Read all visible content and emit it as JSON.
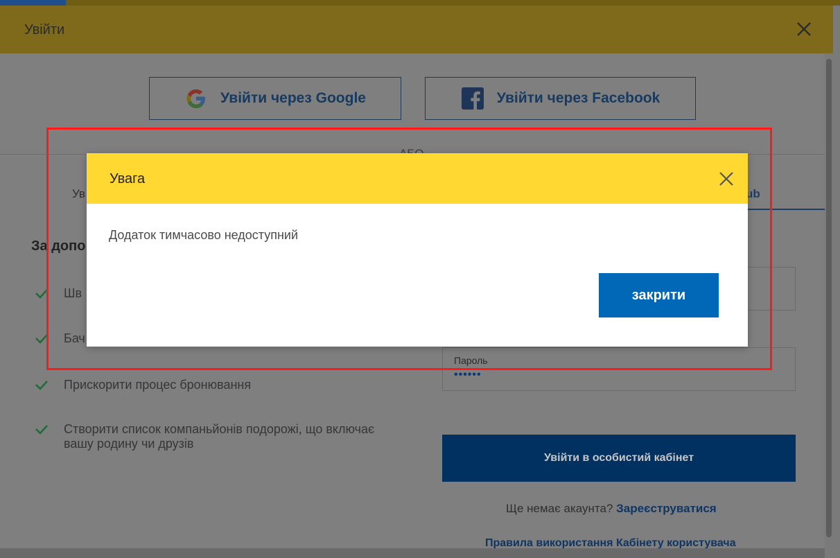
{
  "login_modal": {
    "title": "Увійти",
    "google_button": "Увійти через Google",
    "facebook_button": "Увійти через Facebook",
    "or_text": "АБО",
    "tab_left_partial": "Ув",
    "tab_right_partial": "ub",
    "benefits_title_partial": "За допо",
    "benefits": [
      "Шв",
      "Бач",
      "Прискорити процес бронювання",
      "Створити список компаньйонів подорожі, що включає вашу родину чи друзів"
    ],
    "password_label": "Пароль",
    "password_value": "••••••",
    "submit_button": "Увійти в особистий кабінет",
    "no_account_text": "Ще немає акаунта?",
    "register_link": "Зареєструватися",
    "rules_link": "Правила використання Кабінету користувача"
  },
  "alert": {
    "title": "Увага",
    "message": "Додаток тимчасово недоступний",
    "close_button": "закрити"
  },
  "colors": {
    "alert_header": "#ffd832",
    "alert_button": "#0068b6",
    "annotation": "#ff1a1a"
  }
}
